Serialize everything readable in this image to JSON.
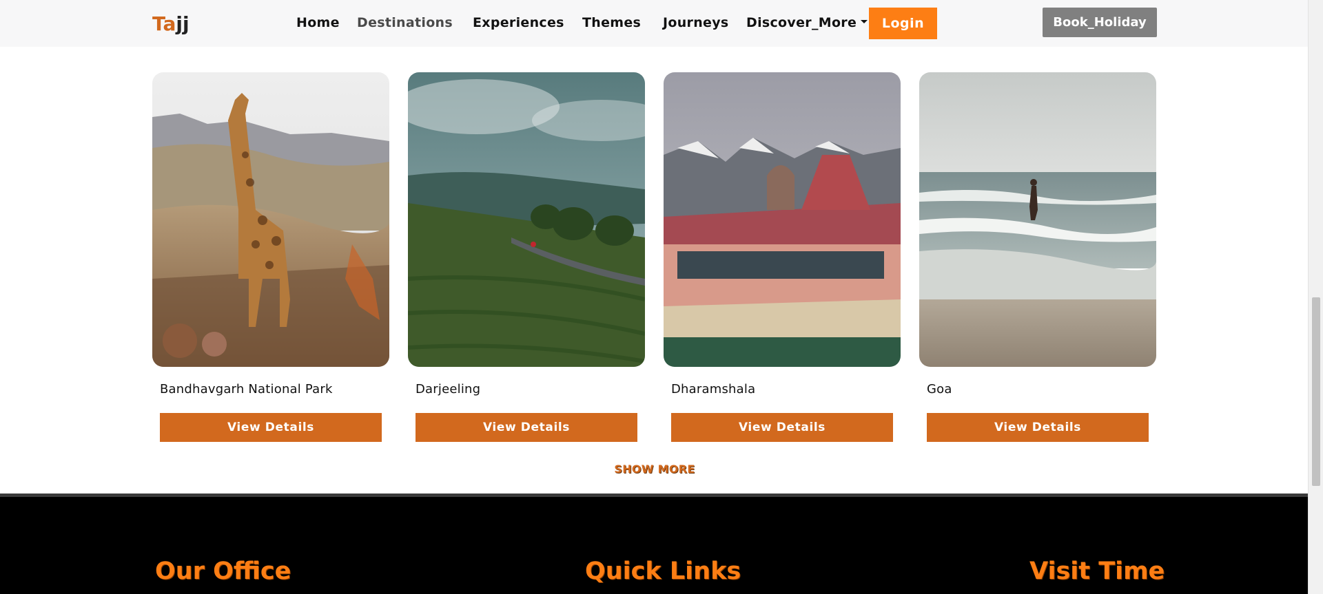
{
  "navbar": {
    "brand": {
      "part1": "Ta",
      "part2": "jj"
    },
    "links": [
      {
        "label": "Home",
        "active": false
      },
      {
        "label": "Destinations",
        "active": true
      },
      {
        "label": "Experiences",
        "active": false
      },
      {
        "label": "Themes",
        "active": false
      },
      {
        "label": "Journeys",
        "active": false
      },
      {
        "label": "Discover_More",
        "active": false
      }
    ],
    "login_label": "Login",
    "book_label": "Book_Holiday"
  },
  "destinations": [
    {
      "name": "Bandhavgarh National Park",
      "button": "View Details",
      "image": "giraffe-savanna"
    },
    {
      "name": "Darjeeling",
      "button": "View Details",
      "image": "tea-hills"
    },
    {
      "name": "Dharamshala",
      "button": "View Details",
      "image": "cricket-stadium-mountains"
    },
    {
      "name": "Goa",
      "button": "View Details",
      "image": "beach-waves"
    }
  ],
  "show_more_label": "SHOW MORE",
  "footer": {
    "headings": [
      "Our Office",
      "Quick Links",
      "Visit Time"
    ]
  },
  "colors": {
    "accent": "#d2691e",
    "login": "#fd7e14",
    "book": "#808080",
    "footer_bg": "#000000"
  }
}
